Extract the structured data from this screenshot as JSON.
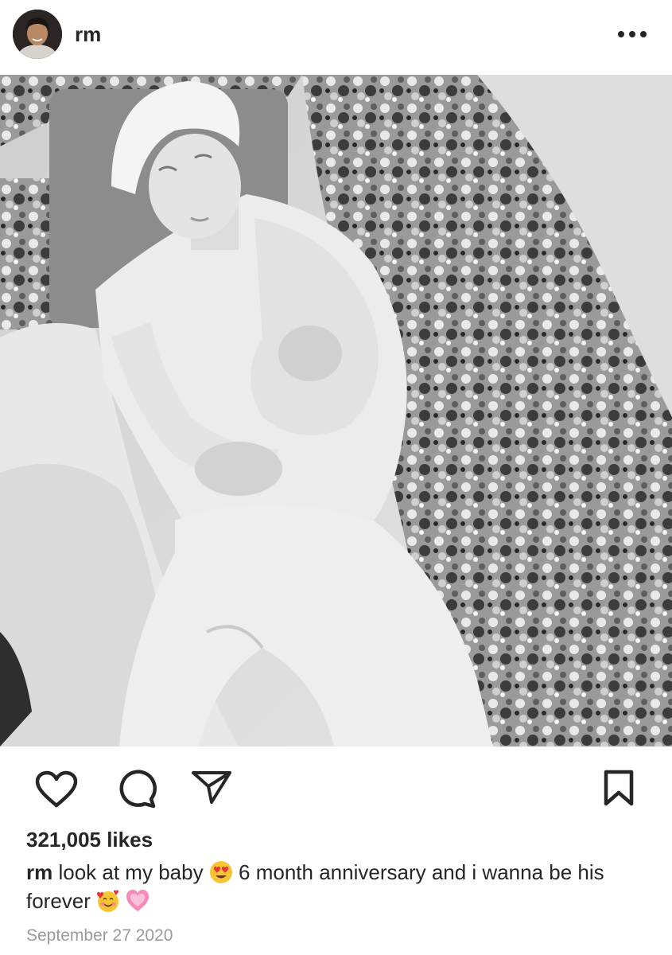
{
  "post": {
    "username": "rm",
    "likes": "321,005 likes",
    "caption": {
      "author": "rm",
      "part1": "look at my baby",
      "emoji1": "heart-eyes-emoji",
      "part2": "6 month anniversary and i wanna be his forever",
      "emoji2": "smiling-face-with-hearts-emoji",
      "emoji3": "growing-heart-emoji"
    },
    "date": "September 27 2020"
  },
  "icons": {
    "like": "heart-outline-icon",
    "comment": "comment-bubble-icon",
    "share": "paper-plane-icon",
    "save": "bookmark-icon",
    "more": "more-options-icon"
  },
  "colors": {
    "text": "#262626",
    "secondary_text": "#9a9a9a",
    "background": "#ffffff"
  }
}
